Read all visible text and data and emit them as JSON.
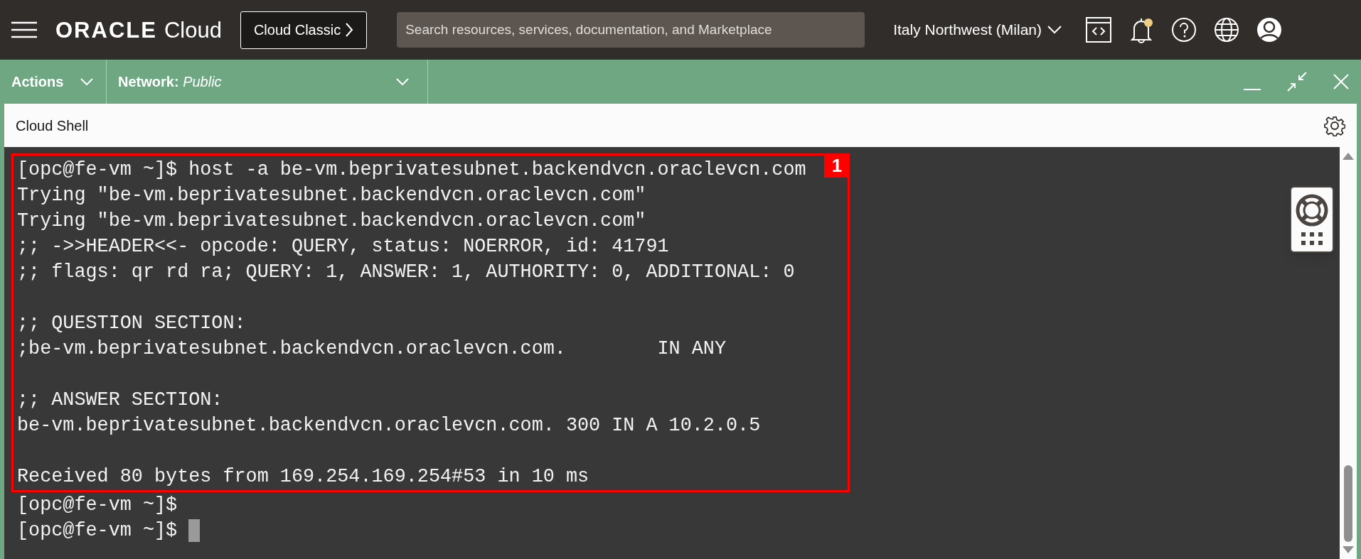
{
  "header": {
    "logo_word": "ORACLE",
    "logo_product": "Cloud",
    "classic_button": "Cloud Classic",
    "search": {
      "placeholder": "Search resources, services, documentation, and Marketplace"
    },
    "region": "Italy Northwest (Milan)",
    "notification_unread": true
  },
  "toolbar": {
    "actions": "Actions",
    "network_label": "Network:",
    "network_value": "Public"
  },
  "panel": {
    "title": "Cloud Shell"
  },
  "terminal": {
    "annotation": {
      "badge": "1",
      "paragraphs": [
        [
          "[opc@fe-vm ~]$ host -a be-vm.beprivatesubnet.backendvcn.oraclevcn.com",
          "Trying \"be-vm.beprivatesubnet.backendvcn.oraclevcn.com\"",
          "Trying \"be-vm.beprivatesubnet.backendvcn.oraclevcn.com\"",
          ";; ->>HEADER<<- opcode: QUERY, status: NOERROR, id: 41791",
          ";; flags: qr rd ra; QUERY: 1, ANSWER: 1, AUTHORITY: 0, ADDITIONAL: 0"
        ],
        [
          ";; QUESTION SECTION:",
          ";be-vm.beprivatesubnet.backendvcn.oraclevcn.com.        IN ANY"
        ],
        [
          ";; ANSWER SECTION:",
          "be-vm.beprivatesubnet.backendvcn.oraclevcn.com. 300 IN A 10.2.0.5"
        ],
        [
          "Received 80 bytes from 169.254.169.254#53 in 10 ms"
        ]
      ]
    },
    "lines": [
      "[opc@fe-vm ~]$",
      "[opc@fe-vm ~]$"
    ]
  }
}
